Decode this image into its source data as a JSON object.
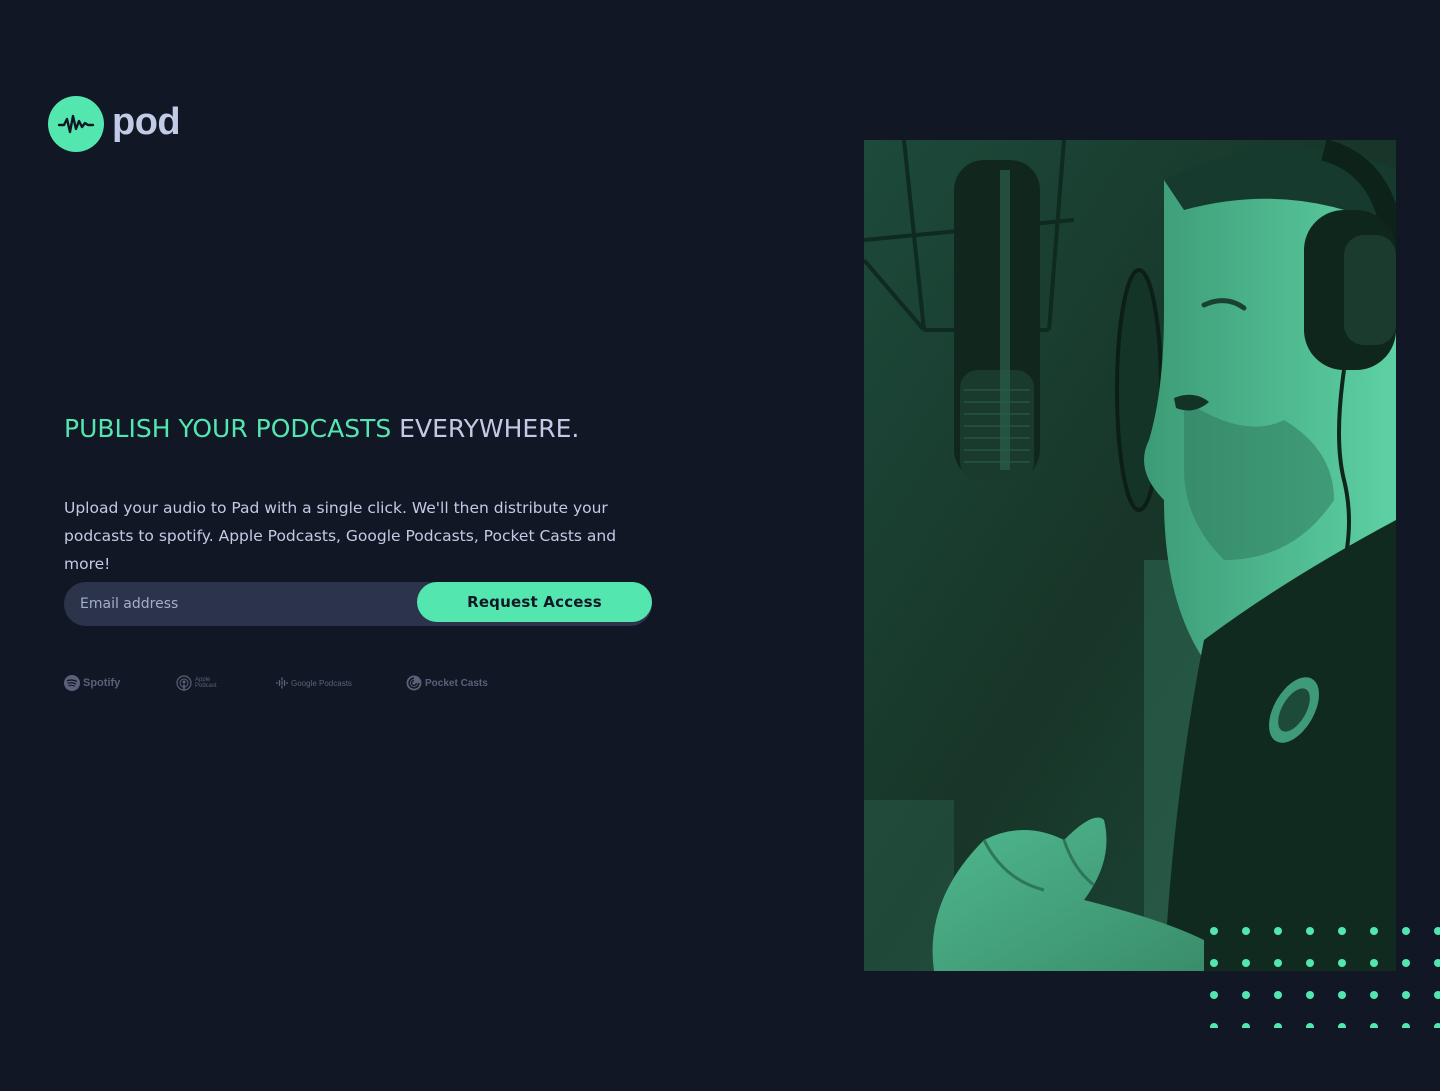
{
  "brand": {
    "name": "pod",
    "logo_icon": "waveform-icon",
    "accent_color": "#54E6AF",
    "background_color": "#121725"
  },
  "hero": {
    "headline_accent": "PUBLISH YOUR PODCASTS",
    "headline_rest": "EVERYWHERE.",
    "description": "Upload your audio to Pad with a single click. We'll then distribute your podcasts to spotify. Apple Podcasts, Google Podcasts, Pocket Casts and more!"
  },
  "form": {
    "email_placeholder": "Email address",
    "email_value": "",
    "submit_label": "Request Access"
  },
  "platforms": {
    "spotify": "Spotify",
    "apple_line1": "Apple",
    "apple_line2": "Podcast",
    "google": "Google Podcasts",
    "pocket": "Pocket Casts"
  },
  "image": {
    "subject": "man-singing-into-studio-microphone-photo",
    "tint_color": "#54E6AF"
  }
}
